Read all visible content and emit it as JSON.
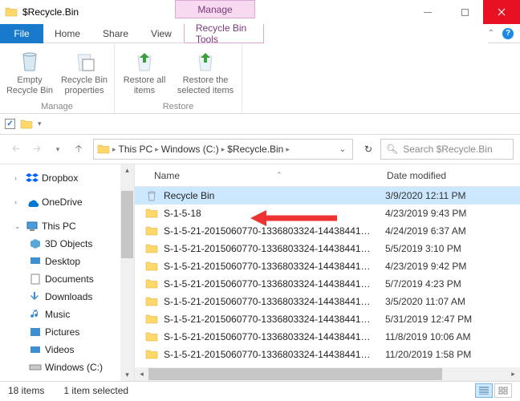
{
  "window": {
    "title": "$Recycle.Bin",
    "contextual_tab": "Manage"
  },
  "tabs": {
    "file": "File",
    "home": "Home",
    "share": "Share",
    "view": "View",
    "recycle_tools": "Recycle Bin Tools"
  },
  "ribbon": {
    "manage_group": "Manage",
    "restore_group": "Restore",
    "empty": "Empty Recycle Bin",
    "props": "Recycle Bin properties",
    "restore_all": "Restore all items",
    "restore_sel": "Restore the selected items"
  },
  "breadcrumb": {
    "this_pc": "This PC",
    "drive": "Windows (C:)",
    "folder": "$Recycle.Bin"
  },
  "search": {
    "placeholder": "Search $Recycle.Bin"
  },
  "columns": {
    "name": "Name",
    "date": "Date modified"
  },
  "navtree": {
    "dropbox": "Dropbox",
    "onedrive": "OneDrive",
    "thispc": "This PC",
    "objects3d": "3D Objects",
    "desktop": "Desktop",
    "documents": "Documents",
    "downloads": "Downloads",
    "music": "Music",
    "pictures": "Pictures",
    "videos": "Videos",
    "windowsc": "Windows (C:)"
  },
  "files": [
    {
      "name": "Recycle Bin",
      "date": "3/9/2020 12:11 PM",
      "icon": "recycle",
      "selected": true
    },
    {
      "name": "S-1-5-18",
      "date": "4/23/2019 9:43 PM",
      "icon": "folder"
    },
    {
      "name": "S-1-5-21-2015060770-1336803324-14438441…",
      "date": "4/24/2019 6:37 AM",
      "icon": "folder"
    },
    {
      "name": "S-1-5-21-2015060770-1336803324-14438441…",
      "date": "5/5/2019 3:10 PM",
      "icon": "folder"
    },
    {
      "name": "S-1-5-21-2015060770-1336803324-14438441…",
      "date": "4/23/2019 9:42 PM",
      "icon": "folder"
    },
    {
      "name": "S-1-5-21-2015060770-1336803324-14438441…",
      "date": "5/7/2019 4:23 PM",
      "icon": "folder"
    },
    {
      "name": "S-1-5-21-2015060770-1336803324-14438441…",
      "date": "3/5/2020 11:07 AM",
      "icon": "folder"
    },
    {
      "name": "S-1-5-21-2015060770-1336803324-14438441…",
      "date": "5/31/2019 12:47 PM",
      "icon": "folder"
    },
    {
      "name": "S-1-5-21-2015060770-1336803324-14438441…",
      "date": "11/8/2019 10:06 AM",
      "icon": "folder"
    },
    {
      "name": "S-1-5-21-2015060770-1336803324-14438441…",
      "date": "11/20/2019 1:58 PM",
      "icon": "folder"
    }
  ],
  "status": {
    "count": "18 items",
    "selected": "1 item selected"
  }
}
